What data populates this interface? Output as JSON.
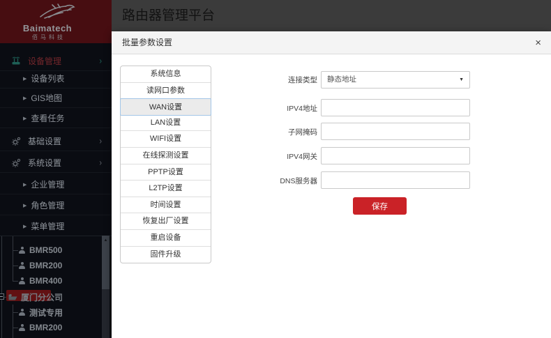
{
  "header": {
    "title": "路由器管理平台"
  },
  "sidebar": {
    "logo": {
      "brand": "Baimatech",
      "brand_cn": "佰马科技",
      "icon": "horse-logo"
    },
    "menu": [
      {
        "label": "设备管理",
        "icon": "router-icon",
        "active": true
      },
      {
        "label": "设备列表"
      },
      {
        "label": "GIS地图"
      },
      {
        "label": "查看任务"
      },
      {
        "label": "基础设置",
        "icon": "gear-icon"
      },
      {
        "label": "系统设置",
        "icon": "gear-icon"
      },
      {
        "label": "企业管理"
      },
      {
        "label": "角色管理"
      },
      {
        "label": "菜单管理"
      }
    ],
    "tree": [
      {
        "label": "BMR500",
        "type": "device"
      },
      {
        "label": "BMR200",
        "type": "device"
      },
      {
        "label": "BMR400",
        "type": "device"
      },
      {
        "label": "厦门分公司",
        "type": "folder",
        "selected": true
      },
      {
        "label": "测试专用",
        "type": "device"
      },
      {
        "label": "BMR200",
        "type": "device"
      }
    ]
  },
  "modal": {
    "title": "批量参数设置",
    "close_label": "×",
    "tabs": [
      {
        "label": "系统信息"
      },
      {
        "label": "读网口参数"
      },
      {
        "label": "WAN设置",
        "selected": true
      },
      {
        "label": "LAN设置"
      },
      {
        "label": "WIFI设置"
      },
      {
        "label": "在线探测设置"
      },
      {
        "label": "PPTP设置"
      },
      {
        "label": "L2TP设置"
      },
      {
        "label": "时间设置"
      },
      {
        "label": "恢复出厂设置"
      },
      {
        "label": "重启设备"
      },
      {
        "label": "固件升级"
      }
    ],
    "form": {
      "fields": [
        {
          "label": "连接类型",
          "type": "select",
          "value": "静态地址"
        },
        {
          "label": "IPV4地址",
          "type": "input",
          "value": ""
        },
        {
          "label": "子网掩码",
          "type": "input",
          "value": ""
        },
        {
          "label": "IPV4网关",
          "type": "input",
          "value": ""
        },
        {
          "label": "DNS服务器",
          "type": "input",
          "value": ""
        }
      ],
      "save_label": "保存"
    }
  },
  "icons": {
    "caret_down": "▼",
    "sub_triangle": "▶",
    "chevron_right": "›",
    "scroll_up": "▲"
  },
  "colors": {
    "accent_red": "#ca2227",
    "logo_bg": "#470d11",
    "sidebar_bg": "#0a0c12",
    "header_bg": "#3b3b3b",
    "active_menu_red": "#73262b",
    "teal_icon": "#1e6056",
    "selected_tree_bg": "#621113",
    "selected_tab_border": "#a3c6e8"
  }
}
